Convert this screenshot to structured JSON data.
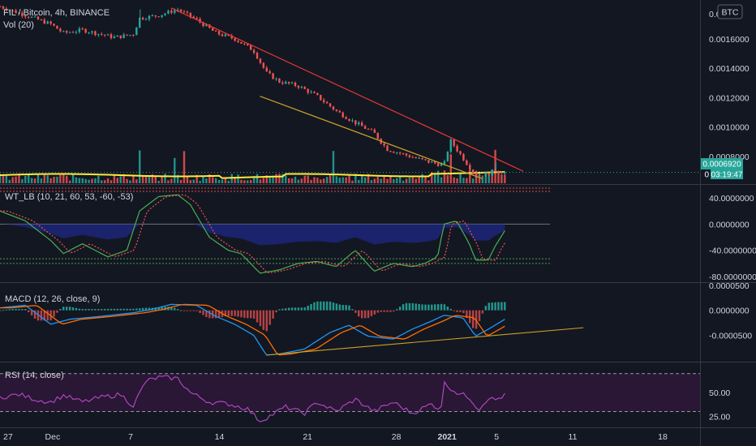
{
  "header": {
    "symbol_line": "FIL / Bitcoin, 4h, BINANCE",
    "currency_button": "BTC"
  },
  "colors": {
    "background": "#131722",
    "up": "#26a69a",
    "down": "#ef5350",
    "trendline_resistance": "#e53935",
    "trendline_support": "#c9a227",
    "volume_ma": "#ffeb3b",
    "last_price_badge": "#26a69a",
    "wt1": "#4caf50",
    "wt2": "#ef5350",
    "wt_fill": "#1e2a8a",
    "macd_line": "#2196f3",
    "signal_line": "#ff6d00",
    "rsi_line": "#ab47bc",
    "rsi_band": "#2a1635"
  },
  "chart_data": [
    {
      "type": "candlestick",
      "pane": "price",
      "title": "FIL / Bitcoin, 4h, BINANCE",
      "ylim": [
        0.00064,
        0.00182
      ],
      "y_ticks": [
        "0.0016000",
        "0.0014000",
        "0.0012000",
        "0.0010000",
        "0.0008000"
      ],
      "top_tick_partial": "0.00",
      "last_price": "0.0006920",
      "countdown": "03:19:47",
      "countdown_prefix": "0",
      "price_path": [
        [
          0,
          0.00182
        ],
        [
          4,
          0.00176
        ],
        [
          8,
          0.0017
        ],
        [
          10,
          0.00164
        ],
        [
          13,
          0.00166
        ],
        [
          16,
          0.00163
        ],
        [
          18,
          0.00161
        ],
        [
          21,
          0.00163
        ],
        [
          22,
          0.00174
        ],
        [
          25,
          0.00176
        ],
        [
          28,
          0.0018
        ],
        [
          31,
          0.00173
        ],
        [
          34,
          0.00164
        ],
        [
          37,
          0.0016
        ],
        [
          40,
          0.00152
        ],
        [
          42,
          0.00137
        ],
        [
          44,
          0.00131
        ],
        [
          47,
          0.00128
        ],
        [
          50,
          0.00121
        ],
        [
          53,
          0.00111
        ],
        [
          56,
          0.00103
        ],
        [
          59,
          0.00096
        ],
        [
          61,
          0.00085
        ],
        [
          64,
          0.00081
        ],
        [
          67,
          0.00077
        ],
        [
          70,
          0.00074
        ],
        [
          71,
          0.00091
        ],
        [
          73,
          0.00079
        ],
        [
          75,
          0.00067
        ],
        [
          77,
          0.00068
        ],
        [
          78,
          0.00071
        ],
        [
          79.6,
          0.00069
        ]
      ],
      "trendlines": [
        {
          "name": "descending-resistance",
          "from": [
            27.0,
            0.00181
          ],
          "to": [
            82.5,
            0.0007
          ]
        },
        {
          "name": "descending-support",
          "from": [
            41.0,
            0.00121
          ],
          "to": [
            76.0,
            0.00065
          ]
        }
      ]
    },
    {
      "type": "bar",
      "pane": "volume",
      "legend": "Vol (20)"
    },
    {
      "type": "line",
      "pane": "wavetrend",
      "legend": "WT_LB (10, 21, 60, 53, -60, -53)",
      "ylim": [
        -85,
        50
      ],
      "y_ticks": [
        "40.0000000",
        "0.0000000",
        "-40.0000000",
        "-80.0000000"
      ],
      "levels": [
        60,
        53,
        0,
        -53,
        -60
      ],
      "wt1_path": [
        [
          0,
          20
        ],
        [
          4,
          5
        ],
        [
          8,
          -25
        ],
        [
          10,
          -45
        ],
        [
          13,
          -30
        ],
        [
          17,
          -50
        ],
        [
          20,
          -40
        ],
        [
          22,
          20
        ],
        [
          25,
          42
        ],
        [
          28,
          45
        ],
        [
          30,
          30
        ],
        [
          33,
          -20
        ],
        [
          36,
          -40
        ],
        [
          38,
          -45
        ],
        [
          41,
          -75
        ],
        [
          44,
          -70
        ],
        [
          47,
          -60
        ],
        [
          50,
          -57
        ],
        [
          53,
          -65
        ],
        [
          56,
          -40
        ],
        [
          59,
          -72
        ],
        [
          62,
          -60
        ],
        [
          65,
          -65
        ],
        [
          67,
          -60
        ],
        [
          69,
          -50
        ],
        [
          70,
          0
        ],
        [
          72,
          5
        ],
        [
          74,
          -30
        ],
        [
          75,
          -55
        ],
        [
          77,
          -55
        ],
        [
          78,
          -35
        ],
        [
          79.6,
          -10
        ]
      ]
    },
    {
      "type": "line",
      "pane": "macd",
      "legend": "MACD (12, 26, close, 9)",
      "ylim": [
        -0.0001,
        5e-05
      ],
      "y_ticks": [
        "0.0000000",
        "-0.0000500"
      ],
      "top_tick_partial": "0.0000500",
      "macd_path": [
        [
          0,
          5e-06
        ],
        [
          4,
          1e-05
        ],
        [
          8,
          -2.8e-05
        ],
        [
          11,
          -1.8e-05
        ],
        [
          16,
          -1.2e-05
        ],
        [
          21,
          -5e-06
        ],
        [
          24,
          2e-06
        ],
        [
          27,
          1.2e-05
        ],
        [
          31,
          1e-05
        ],
        [
          34,
          -1.2e-05
        ],
        [
          37,
          -2.8e-05
        ],
        [
          40,
          -5e-05
        ],
        [
          42,
          -9e-05
        ],
        [
          44,
          -8.8e-05
        ],
        [
          48,
          -7.8e-05
        ],
        [
          52,
          -4.5e-05
        ],
        [
          55,
          -3e-05
        ],
        [
          58,
          -5.2e-05
        ],
        [
          62,
          -5.8e-05
        ],
        [
          65,
          -3.8e-05
        ],
        [
          68,
          -2.2e-05
        ],
        [
          70,
          -1e-05
        ],
        [
          73,
          -1.5e-05
        ],
        [
          75,
          -5.2e-05
        ],
        [
          77,
          -3.8e-05
        ],
        [
          79.6,
          -1.8e-05
        ]
      ],
      "trendlines": [
        {
          "name": "ascending-support",
          "from": [
            42.0,
            -9e-05
          ],
          "to": [
            92.0,
            -3.5e-05
          ]
        }
      ]
    },
    {
      "type": "line",
      "pane": "rsi",
      "legend": "RSI (14, close)",
      "ylim": [
        15,
        80
      ],
      "y_ticks": [
        "50.00",
        "25.00"
      ],
      "bands": [
        30,
        70
      ],
      "rsi_path": [
        [
          0,
          45
        ],
        [
          3,
          48
        ],
        [
          6,
          42
        ],
        [
          8,
          40
        ],
        [
          10,
          47
        ],
        [
          13,
          40
        ],
        [
          16,
          45
        ],
        [
          19,
          48
        ],
        [
          21,
          36
        ],
        [
          23,
          62
        ],
        [
          25,
          66
        ],
        [
          28,
          65
        ],
        [
          30,
          50
        ],
        [
          33,
          40
        ],
        [
          36,
          38
        ],
        [
          39,
          33
        ],
        [
          41,
          20
        ],
        [
          43,
          27
        ],
        [
          45,
          35
        ],
        [
          48,
          28
        ],
        [
          50,
          40
        ],
        [
          53,
          30
        ],
        [
          56,
          43
        ],
        [
          59,
          30
        ],
        [
          62,
          40
        ],
        [
          65,
          28
        ],
        [
          68,
          38
        ],
        [
          69.5,
          32
        ],
        [
          70,
          60
        ],
        [
          72,
          50
        ],
        [
          74,
          45
        ],
        [
          75.5,
          32
        ],
        [
          77,
          45
        ],
        [
          78,
          42
        ],
        [
          79.6,
          47
        ]
      ]
    }
  ],
  "x_axis": {
    "labels": [
      {
        "text": "27",
        "x": 0.5
      },
      {
        "text": "Dec",
        "x": 8.3
      },
      {
        "text": "7",
        "x": 20.6
      },
      {
        "text": "14",
        "x": 34.6
      },
      {
        "text": "21",
        "x": 48.5
      },
      {
        "text": "28",
        "x": 62.5
      },
      {
        "text": "2021",
        "x": 70.5
      },
      {
        "text": "5",
        "x": 78.3
      },
      {
        "text": "11",
        "x": 90.3
      },
      {
        "text": "18",
        "x": 104.5
      }
    ]
  }
}
